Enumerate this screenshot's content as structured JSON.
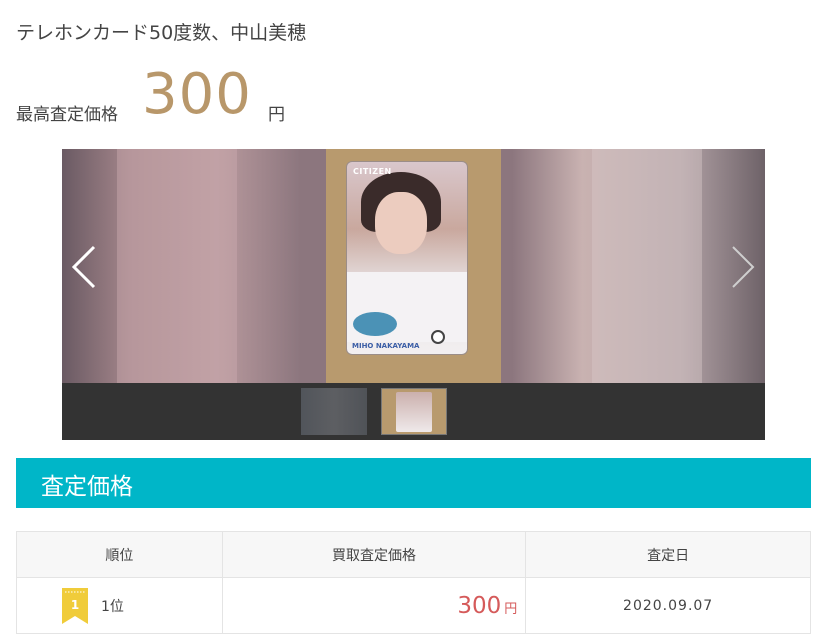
{
  "product": {
    "title": "テレホンカード50度数、中山美穂"
  },
  "max_price": {
    "label": "最高査定価格",
    "value": "300",
    "unit": "円"
  },
  "carousel": {
    "card_brand": "CITIZEN",
    "card_name": "MIHO NAKAYAMA",
    "prev_icon": "chevron-left-icon",
    "next_icon": "chevron-right-icon",
    "thumbnail_count": 2,
    "active_index": 1
  },
  "section": {
    "title": "査定価格"
  },
  "table": {
    "headers": [
      "順位",
      "買取査定価格",
      "査定日"
    ],
    "rows": [
      {
        "badge": "1",
        "rank": "1位",
        "price": "300",
        "unit": "円",
        "date": "2020.09.07"
      }
    ]
  },
  "colors": {
    "accent": "#00b6c8",
    "price_gold": "#b8976a",
    "price_red": "#d55a5a",
    "badge_gold": "#f0cc3a"
  }
}
